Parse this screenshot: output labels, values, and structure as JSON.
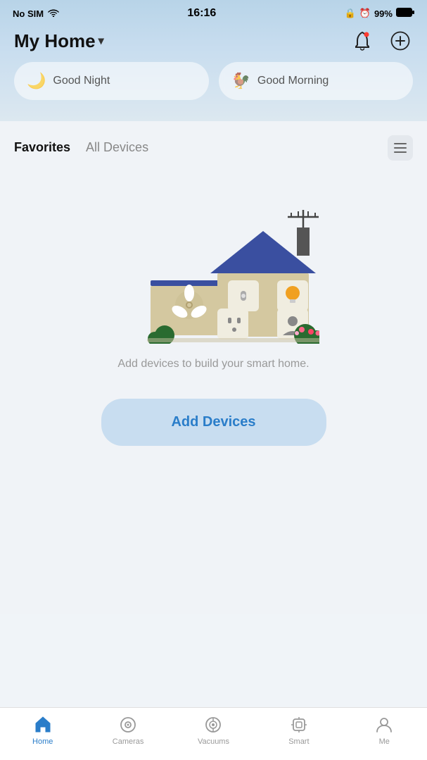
{
  "statusBar": {
    "carrier": "No SIM",
    "time": "16:16",
    "battery": "99%",
    "lockIcon": "🔒",
    "alarmIcon": "⏰"
  },
  "header": {
    "title": "My Home",
    "chevron": "▼",
    "bellIcon": "bell-icon",
    "addIcon": "add-icon"
  },
  "scenes": [
    {
      "id": "good-night",
      "label": "Good Night",
      "icon": "🌙"
    },
    {
      "id": "good-morning",
      "label": "Good Morning",
      "icon": "🐓"
    }
  ],
  "tabs": [
    {
      "id": "favorites",
      "label": "Favorites",
      "active": true
    },
    {
      "id": "all-devices",
      "label": "All Devices",
      "active": false
    }
  ],
  "emptyState": {
    "text": "Add devices to build your smart home.",
    "addButtonLabel": "Add Devices"
  },
  "bottomNav": [
    {
      "id": "home",
      "label": "Home",
      "active": true
    },
    {
      "id": "cameras",
      "label": "Cameras",
      "active": false
    },
    {
      "id": "vacuums",
      "label": "Vacuums",
      "active": false
    },
    {
      "id": "smart",
      "label": "Smart",
      "active": false
    },
    {
      "id": "me",
      "label": "Me",
      "active": false
    }
  ]
}
